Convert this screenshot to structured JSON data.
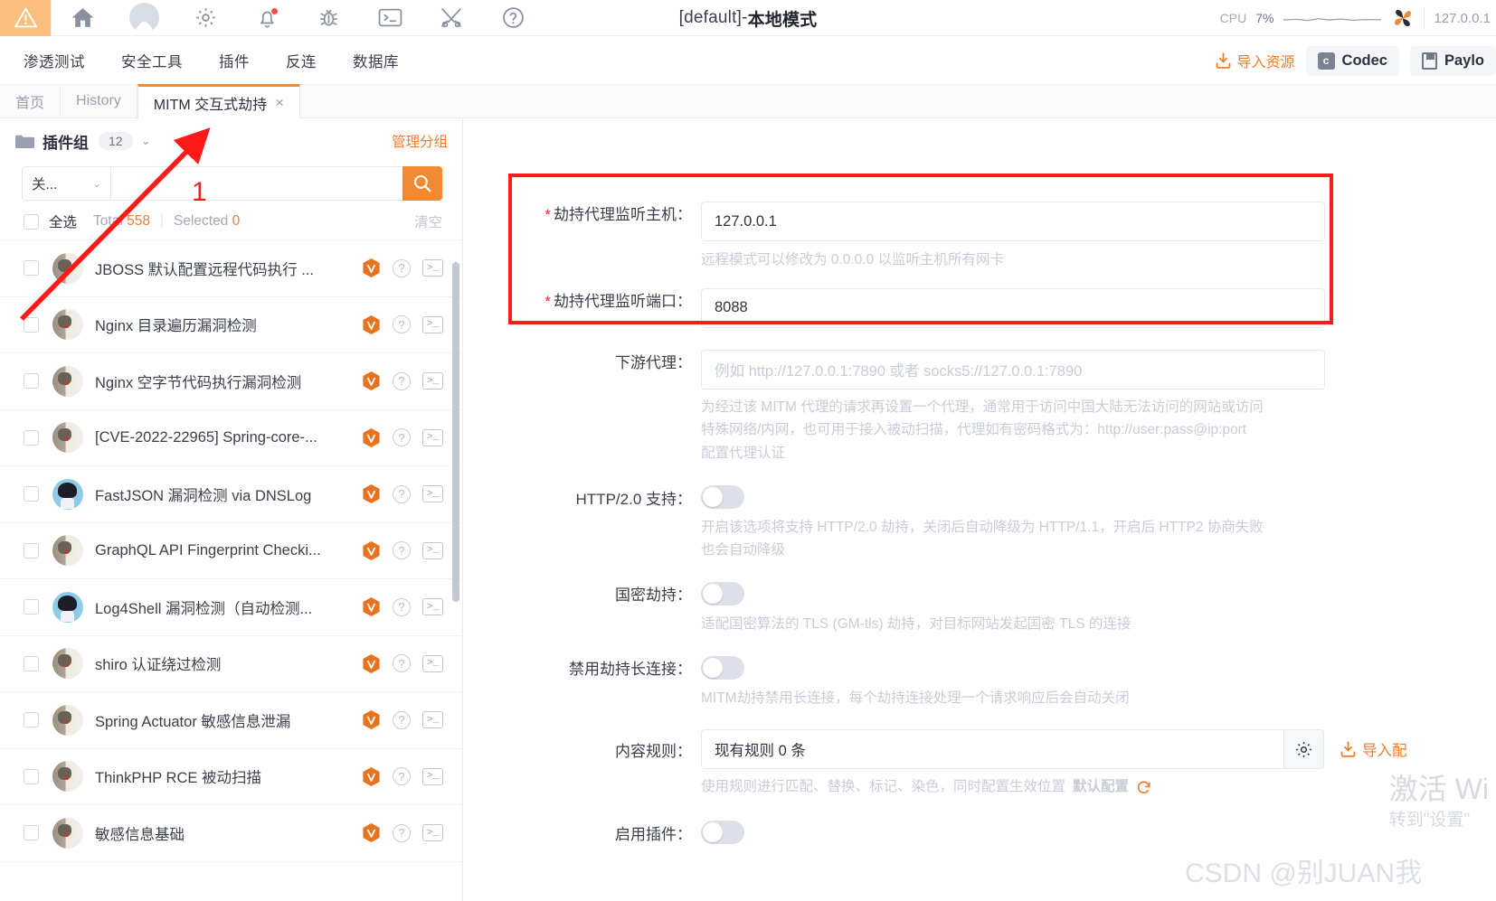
{
  "topbar": {
    "warning_icon": "warning-triangle-icon",
    "icons": [
      "home-icon",
      "user-avatar-icon",
      "gear-icon",
      "bell-icon",
      "bug-icon",
      "terminal-icon",
      "tools-icon",
      "help-icon"
    ],
    "title_plain": "[default]-",
    "title_bold": "本地模式",
    "cpu_label": "CPU",
    "cpu_value": "7%",
    "ip": "127.0.0.1",
    "accent": "#f08a35",
    "warning_bg": "#fac07b"
  },
  "menubar": {
    "items": [
      "渗透测试",
      "安全工具",
      "插件",
      "反连",
      "数据库"
    ],
    "import_resource": "导入资源",
    "codec": "Codec",
    "payload": "Paylo"
  },
  "tabs": [
    {
      "label": "首页",
      "active": false,
      "closable": false
    },
    {
      "label": "History",
      "active": false,
      "closable": false
    },
    {
      "label": "MITM 交互式劫持",
      "active": true,
      "closable": true,
      "close": "×"
    }
  ],
  "sidebar": {
    "group_title": "插件组",
    "group_count": "12",
    "manage_link": "管理分组",
    "filter_value": "关...",
    "search_placeholder": "",
    "select_all": "全选",
    "total_label": "Total",
    "total_value": "558",
    "selected_label": "Selected",
    "selected_value": "0",
    "clear_label": "清空",
    "plugins": [
      {
        "name": "JBOSS 默认配置远程代码执行 ...",
        "avatar": "cat"
      },
      {
        "name": "Nginx 目录遍历漏洞检测",
        "avatar": "cat"
      },
      {
        "name": "Nginx 空字节代码执行漏洞检测",
        "avatar": "cat"
      },
      {
        "name": "[CVE-2022-22965] Spring-core-...",
        "avatar": "cat"
      },
      {
        "name": "FastJSON 漏洞检测 via DNSLog",
        "avatar": "anime"
      },
      {
        "name": "GraphQL API Fingerprint Checki...",
        "avatar": "cat"
      },
      {
        "name": "Log4Shell 漏洞检测（自动检测...",
        "avatar": "anime"
      },
      {
        "name": "shiro 认证绕过检测",
        "avatar": "cat"
      },
      {
        "name": "Spring Actuator 敏感信息泄漏",
        "avatar": "cat"
      },
      {
        "name": "ThinkPHP RCE 被动扫描",
        "avatar": "cat"
      },
      {
        "name": "敏感信息基础",
        "avatar": "cat"
      }
    ]
  },
  "form": {
    "listen_host": {
      "label": "劫持代理监听主机：",
      "required": true,
      "value": "127.0.0.1",
      "hint": "远程模式可以修改为 0.0.0.0 以监听主机所有网卡"
    },
    "listen_port": {
      "label": "劫持代理监听端口：",
      "required": true,
      "value": "8088"
    },
    "downstream_proxy": {
      "label": "下游代理：",
      "placeholder": "例如 http://127.0.0.1:7890 或者 socks5://127.0.0.1:7890",
      "hint_line1": "为经过该 MITM 代理的请求再设置一个代理，通常用于访问中国大陆无法访问的网站或访问",
      "hint_line2": "特殊网络/内网，也可用于接入被动扫描，代理如有密码格式为：http://user:pass@ip:port",
      "link": "配置代理认证"
    },
    "http2": {
      "label": "HTTP/2.0 支持：",
      "enabled": false,
      "hint_line1": "开启该选项将支持 HTTP/2.0 劫持，关闭后自动降级为 HTTP/1.1，开启后 HTTP2 协商失败",
      "hint_line2": "也会自动降级"
    },
    "gmtls": {
      "label": "国密劫持：",
      "enabled": false,
      "hint": "适配国密算法的 TLS (GM-tls) 劫持，对目标网站发起国密 TLS 的连接"
    },
    "disable_keepalive": {
      "label": "禁用劫持长连接：",
      "enabled": false,
      "hint": "MITM劫持禁用长连接，每个劫持连接处理一个请求响应后会自动关闭"
    },
    "content_rules": {
      "label": "内容规则：",
      "value": "现有规则 0 条",
      "gear_icon": "gear-icon",
      "import_label": "导入配",
      "hint_prefix": "使用规则进行匹配、替换、标记、染色，同时配置生效位置",
      "hint_link": "默认配置",
      "refresh_icon": "refresh-icon"
    },
    "enable_plugin": {
      "label": "启用插件：",
      "enabled": false
    }
  },
  "annotations": {
    "red_box": "#ff1a1a",
    "step_number": "1",
    "arrow_color": "#ff1a1a"
  },
  "watermarks": {
    "windows_line1": "激活 Wi",
    "windows_line2": "转到\"设置\"",
    "csdn": "CSDN @别JUAN我"
  }
}
